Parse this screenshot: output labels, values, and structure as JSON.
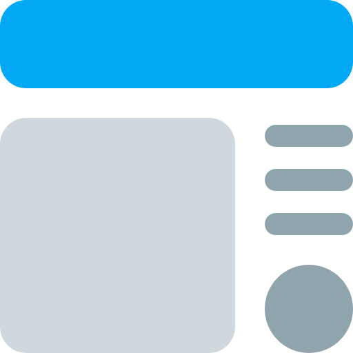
{
  "icon": {
    "name": "dashboard-layout-icon",
    "colors": {
      "header": "#03A9F4",
      "panel": "#CFD8DC",
      "accent": "#90A4AE"
    },
    "elements": {
      "header_bar": "header-bar",
      "content_panel": "content-panel",
      "menu_lines": [
        "menu-line-1",
        "menu-line-2",
        "menu-line-3"
      ],
      "avatar": "avatar-circle"
    }
  }
}
